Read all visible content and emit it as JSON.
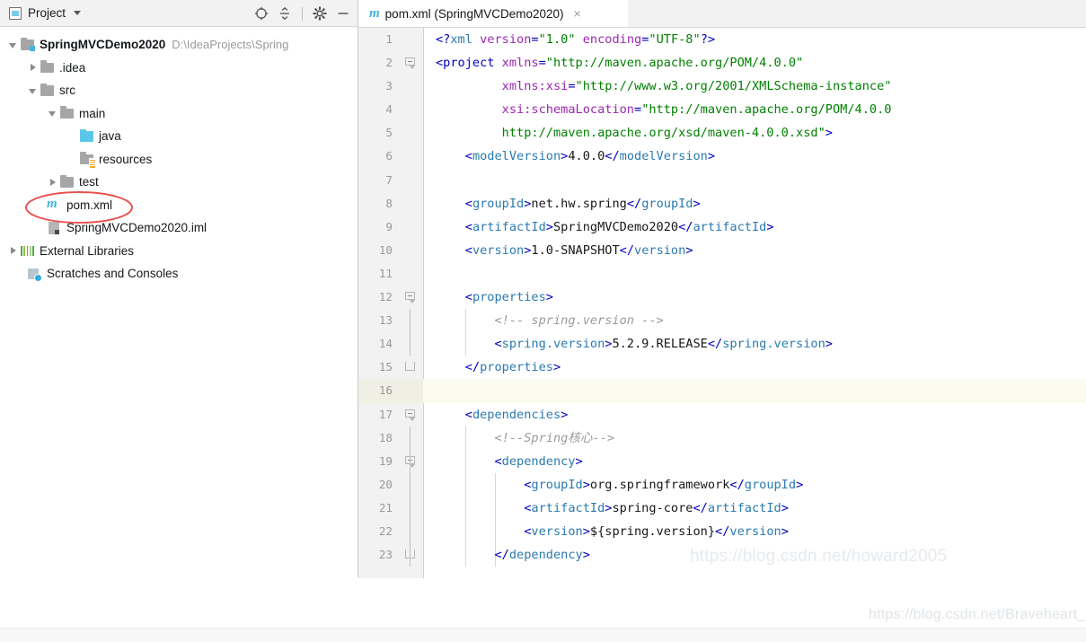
{
  "project_panel": {
    "title": "Project",
    "icons": {
      "window": "project-window-icon",
      "dropdown": "chevron-down-icon",
      "locate": "scroll-from-source-icon",
      "collapse": "collapse-all-icon",
      "settings": "gear-icon",
      "hide": "minimize-icon"
    },
    "tree": [
      {
        "label": "SpringMVCDemo2020",
        "path": "D:\\IdeaProjects\\Spring",
        "icon": "module-folder-icon",
        "twisty": "expanded",
        "depth": 0,
        "bold": true
      },
      {
        "label": ".idea",
        "path": "",
        "icon": "folder-icon",
        "twisty": "collapsed",
        "depth": 1,
        "bold": false
      },
      {
        "label": "src",
        "path": "",
        "icon": "folder-icon",
        "twisty": "expanded",
        "depth": 1,
        "bold": false
      },
      {
        "label": "main",
        "path": "",
        "icon": "folder-icon",
        "twisty": "expanded",
        "depth": 2,
        "bold": false
      },
      {
        "label": "java",
        "path": "",
        "icon": "sources-folder-icon",
        "twisty": "none",
        "depth": 3,
        "bold": false
      },
      {
        "label": "resources",
        "path": "",
        "icon": "resources-folder-icon",
        "twisty": "none",
        "depth": 3,
        "bold": false
      },
      {
        "label": "test",
        "path": "",
        "icon": "folder-icon",
        "twisty": "collapsed",
        "depth": 2,
        "bold": false
      },
      {
        "label": "pom.xml",
        "path": "",
        "icon": "maven-file-icon",
        "twisty": "none",
        "depth": 2,
        "bold": false,
        "annotated": true
      },
      {
        "label": "SpringMVCDemo2020.iml",
        "path": "",
        "icon": "iml-file-icon",
        "twisty": "none",
        "depth": 2,
        "bold": false
      },
      {
        "label": "External Libraries",
        "path": "",
        "icon": "libraries-icon",
        "twisty": "collapsed",
        "depth": 0,
        "bold": false
      },
      {
        "label": "Scratches and Consoles",
        "path": "",
        "icon": "scratches-icon",
        "twisty": "none",
        "depth": 0,
        "bold": false
      }
    ]
  },
  "editor": {
    "tab": {
      "icon": "maven-file-icon",
      "label": "pom.xml (SpringMVCDemo2020)",
      "close": "×"
    },
    "lines": [
      {
        "n": "1",
        "fold": "none"
      },
      {
        "n": "2",
        "fold": "start"
      },
      {
        "n": "3",
        "fold": "none"
      },
      {
        "n": "4",
        "fold": "none"
      },
      {
        "n": "5",
        "fold": "none"
      },
      {
        "n": "6",
        "fold": "none"
      },
      {
        "n": "7",
        "fold": "none"
      },
      {
        "n": "8",
        "fold": "none"
      },
      {
        "n": "9",
        "fold": "none"
      },
      {
        "n": "10",
        "fold": "none"
      },
      {
        "n": "11",
        "fold": "none"
      },
      {
        "n": "12",
        "fold": "start"
      },
      {
        "n": "13",
        "fold": "bar"
      },
      {
        "n": "14",
        "fold": "bar"
      },
      {
        "n": "15",
        "fold": "end",
        "bulb": true
      },
      {
        "n": "16",
        "fold": "none",
        "caret": true
      },
      {
        "n": "17",
        "fold": "start"
      },
      {
        "n": "18",
        "fold": "bar"
      },
      {
        "n": "19",
        "fold": "start2"
      },
      {
        "n": "20",
        "fold": "bar2"
      },
      {
        "n": "21",
        "fold": "bar2"
      },
      {
        "n": "22",
        "fold": "bar2"
      },
      {
        "n": "23",
        "fold": "end2"
      }
    ]
  },
  "watermarks": {
    "editor": "https://blog.csdn.net/howard2005",
    "page": "https://blog.csdn.net/Braveheart_"
  },
  "colors": {
    "tag": "#0000c0",
    "attr": "#9c27b0",
    "string": "#008000",
    "comment": "#9a9a9a",
    "accent": "#3fb4e0",
    "annotation": "#e8514f"
  }
}
